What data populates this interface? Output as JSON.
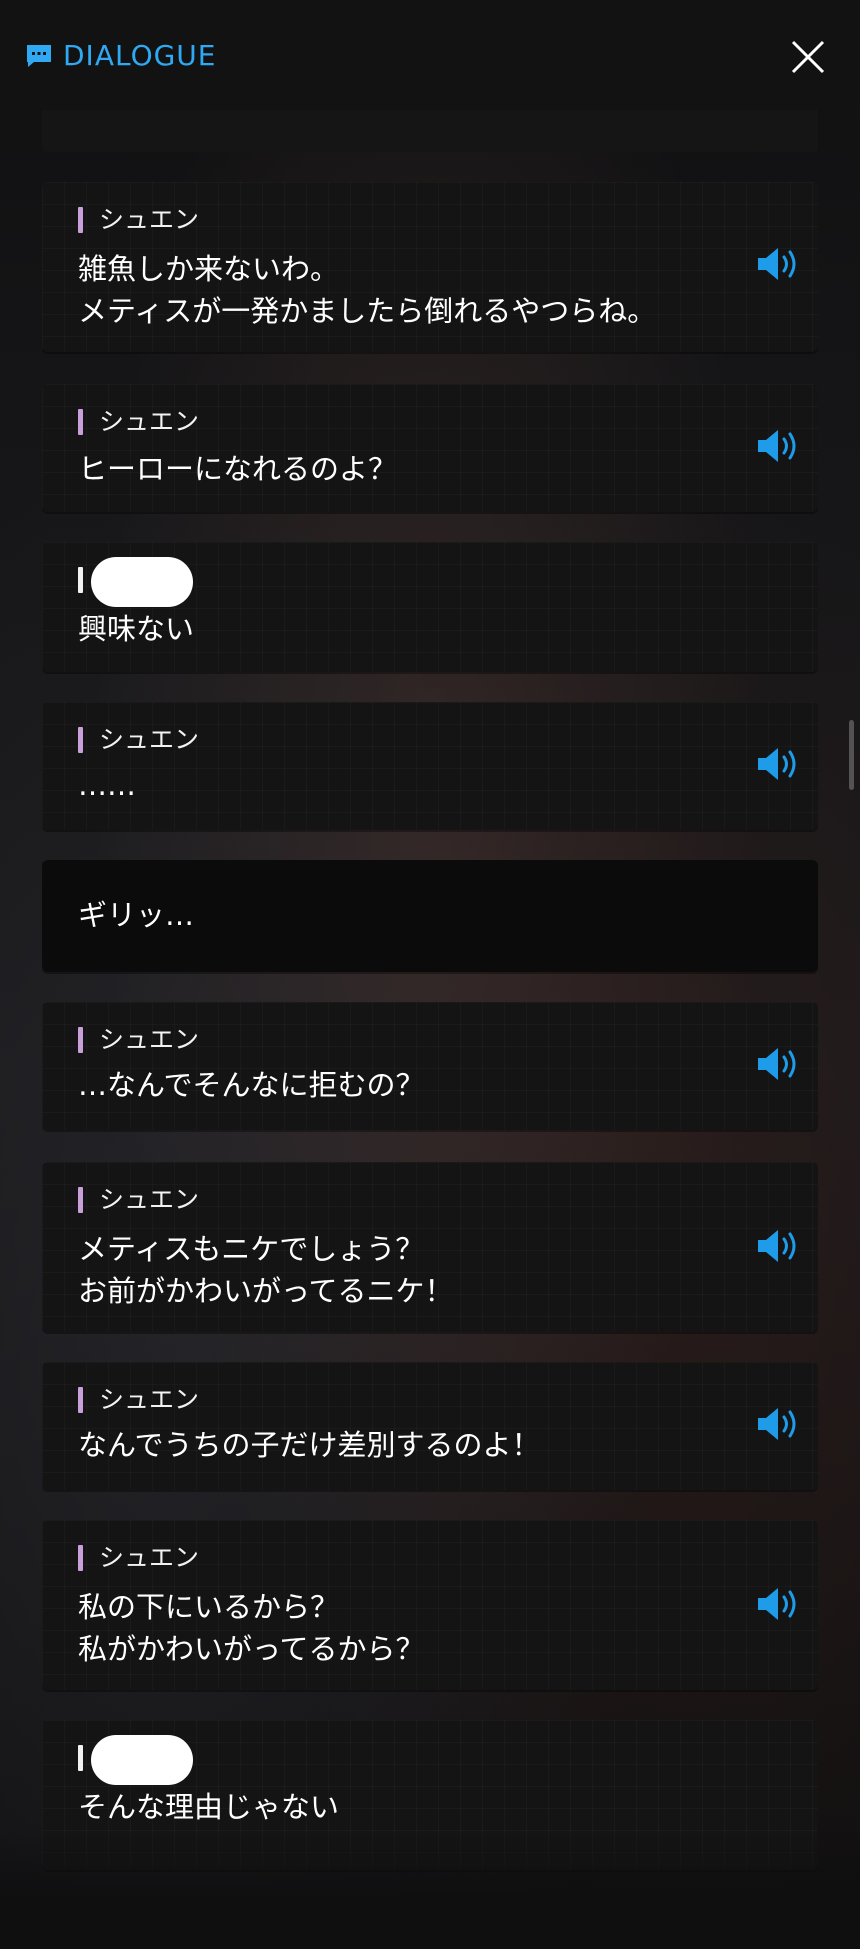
{
  "header": {
    "title": "DIALOGUE",
    "accent_color": "#2fa9f3",
    "icon": "chat-bubble-icon",
    "close_icon": "close-icon"
  },
  "dialogue": [
    {
      "speaker": "シュエン",
      "lines": [
        "雑魚しか来ないわ。",
        "メティスが一発かましたら倒れるやつらね。"
      ],
      "voice": true
    },
    {
      "speaker": "シュエン",
      "lines": [
        "ヒーローになれるのよ？"
      ],
      "voice": true
    },
    {
      "speaker": "",
      "speaker_redacted": true,
      "lines": [
        "興味ない"
      ],
      "voice": false
    },
    {
      "speaker": "シュエン",
      "lines": [
        "……"
      ],
      "voice": true
    },
    {
      "narration": true,
      "lines": [
        "ギリッ…"
      ],
      "voice": false
    },
    {
      "speaker": "シュエン",
      "lines": [
        "…なんでそんなに拒むの？"
      ],
      "voice": true
    },
    {
      "speaker": "シュエン",
      "lines": [
        "メティスもニケでしょう？",
        "お前がかわいがってるニケ！"
      ],
      "voice": true
    },
    {
      "speaker": "シュエン",
      "lines": [
        "なんでうちの子だけ差別するのよ！"
      ],
      "voice": true
    },
    {
      "speaker": "シュエン",
      "lines": [
        "私の下にいるから？",
        "私がかわいがってるから？"
      ],
      "voice": true
    },
    {
      "speaker": "",
      "speaker_redacted": true,
      "lines": [
        "そんな理由じゃない"
      ],
      "voice": false
    }
  ],
  "colors": {
    "speaker_bar": "#c9a0d9",
    "voice_icon": "#1e9be9",
    "card_bg": "#141415"
  },
  "icons": {
    "voice": "speaker-volume-icon"
  }
}
